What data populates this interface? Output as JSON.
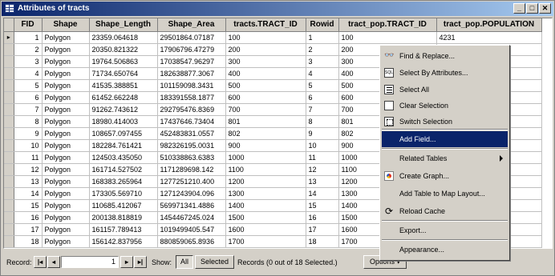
{
  "window": {
    "title": "Attributes of tracts",
    "buttons": [
      "_",
      "□",
      "✕"
    ]
  },
  "table": {
    "columns": [
      "FID",
      "Shape",
      "Shape_Length",
      "Shape_Area",
      "tracts.TRACT_ID",
      "Rowid",
      "tract_pop.TRACT_ID",
      "tract_pop.POPULATION"
    ],
    "current_row_marker": "▸",
    "rows": [
      [
        "1",
        "Polygon",
        "23359.064618",
        "29501864.07187",
        "100",
        "1",
        "100",
        "4231"
      ],
      [
        "2",
        "Polygon",
        "20350.821322",
        "17906796.47279",
        "200",
        "2",
        "200",
        ""
      ],
      [
        "3",
        "Polygon",
        "19764.506863",
        "17038547.96297",
        "300",
        "3",
        "300",
        ""
      ],
      [
        "4",
        "Polygon",
        "71734.650764",
        "182638877.3067",
        "400",
        "4",
        "400",
        ""
      ],
      [
        "5",
        "Polygon",
        "41535.388851",
        "101159098.3431",
        "500",
        "5",
        "500",
        ""
      ],
      [
        "6",
        "Polygon",
        "61452.662248",
        "183391558.1877",
        "600",
        "6",
        "600",
        ""
      ],
      [
        "7",
        "Polygon",
        "91262.743612",
        "292795476.8369",
        "700",
        "7",
        "700",
        ""
      ],
      [
        "8",
        "Polygon",
        "18980.414003",
        "17437646.73404",
        "801",
        "8",
        "801",
        ""
      ],
      [
        "9",
        "Polygon",
        "108657.097455",
        "452483831.0557",
        "802",
        "9",
        "802",
        ""
      ],
      [
        "10",
        "Polygon",
        "182284.761421",
        "982326195.0031",
        "900",
        "10",
        "900",
        ""
      ],
      [
        "11",
        "Polygon",
        "124503.435050",
        "510338863.6383",
        "1000",
        "11",
        "1000",
        ""
      ],
      [
        "12",
        "Polygon",
        "161714.527502",
        "1171289698.142",
        "1100",
        "12",
        "1100",
        ""
      ],
      [
        "13",
        "Polygon",
        "168383.265964",
        "1277251210.400",
        "1200",
        "13",
        "1200",
        ""
      ],
      [
        "14",
        "Polygon",
        "173305.569710",
        "1271243904.096",
        "1300",
        "14",
        "1300",
        ""
      ],
      [
        "15",
        "Polygon",
        "110685.412067",
        "569971341.4886",
        "1400",
        "15",
        "1400",
        ""
      ],
      [
        "16",
        "Polygon",
        "200138.818819",
        "1454467245.024",
        "1500",
        "16",
        "1500",
        ""
      ],
      [
        "17",
        "Polygon",
        "161157.789413",
        "1019499405.547",
        "1600",
        "17",
        "1600",
        ""
      ],
      [
        "18",
        "Polygon",
        "156142.837956",
        "880859065.8936",
        "1700",
        "18",
        "1700",
        ""
      ]
    ]
  },
  "statusbar": {
    "record_label": "Record:",
    "first": "|◂",
    "prev": "◂",
    "next": "▸",
    "last": "▸|",
    "record_value": "1",
    "show_label": "Show:",
    "all_button": "All",
    "selected_button": "Selected",
    "records_text": "Records (0 out of 18 Selected.)",
    "options_button": "Options ▾"
  },
  "context_menu": {
    "items": [
      {
        "label": "Find & Replace...",
        "icon": "binoculars-icon"
      },
      {
        "label": "Select By Attributes...",
        "icon": "sql-icon"
      },
      {
        "label": "Select All",
        "icon": "select-all-icon"
      },
      {
        "label": "Clear Selection",
        "icon": "clear-selection-icon"
      },
      {
        "label": "Switch Selection",
        "icon": "switch-selection-icon"
      },
      {
        "label": "Add Field...",
        "icon": "",
        "highlighted": true
      },
      {
        "label": "Related Tables",
        "icon": "",
        "submenu": true
      },
      {
        "label": "Create Graph...",
        "icon": "graph-icon"
      },
      {
        "label": "Add Table to Map Layout...",
        "icon": ""
      },
      {
        "label": "Reload Cache",
        "icon": "reload-icon"
      },
      {
        "label": "Export...",
        "icon": ""
      },
      {
        "label": "Appearance...",
        "icon": ""
      }
    ]
  }
}
